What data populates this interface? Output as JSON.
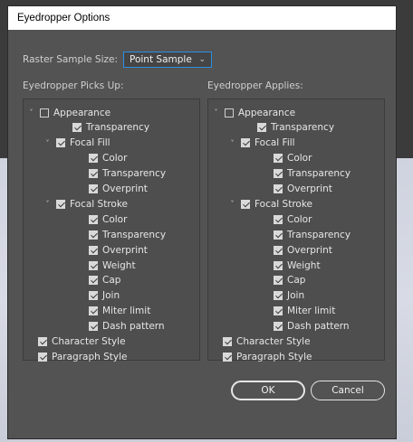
{
  "dialog": {
    "title": "Eyedropper Options",
    "raster_label": "Raster Sample Size:",
    "raster_value": "Point Sample",
    "picks_up_label": "Eyedropper Picks Up:",
    "applies_label": "Eyedropper Applies:",
    "ok_label": "OK",
    "cancel_label": "Cancel"
  },
  "tree": [
    {
      "label": "Appearance",
      "level": 0,
      "chevron": true,
      "checked": false
    },
    {
      "label": "Transparency",
      "level": 2,
      "chevron": false,
      "checked": true
    },
    {
      "label": "Focal Fill",
      "level": 1,
      "chevron": true,
      "checked": true
    },
    {
      "label": "Color",
      "level": 3,
      "chevron": false,
      "checked": true
    },
    {
      "label": "Transparency",
      "level": 3,
      "chevron": false,
      "checked": true
    },
    {
      "label": "Overprint",
      "level": 3,
      "chevron": false,
      "checked": true
    },
    {
      "label": "Focal Stroke",
      "level": 1,
      "chevron": true,
      "checked": true
    },
    {
      "label": "Color",
      "level": 3,
      "chevron": false,
      "checked": true
    },
    {
      "label": "Transparency",
      "level": 3,
      "chevron": false,
      "checked": true
    },
    {
      "label": "Overprint",
      "level": 3,
      "chevron": false,
      "checked": true
    },
    {
      "label": "Weight",
      "level": 3,
      "chevron": false,
      "checked": true
    },
    {
      "label": "Cap",
      "level": 3,
      "chevron": false,
      "checked": true
    },
    {
      "label": "Join",
      "level": 3,
      "chevron": false,
      "checked": true
    },
    {
      "label": "Miter limit",
      "level": 3,
      "chevron": false,
      "checked": true
    },
    {
      "label": "Dash pattern",
      "level": 3,
      "chevron": false,
      "checked": true
    },
    {
      "label": "Character Style",
      "level": -1,
      "chevron": false,
      "checked": true
    },
    {
      "label": "Paragraph Style",
      "level": -1,
      "chevron": false,
      "checked": true
    }
  ]
}
